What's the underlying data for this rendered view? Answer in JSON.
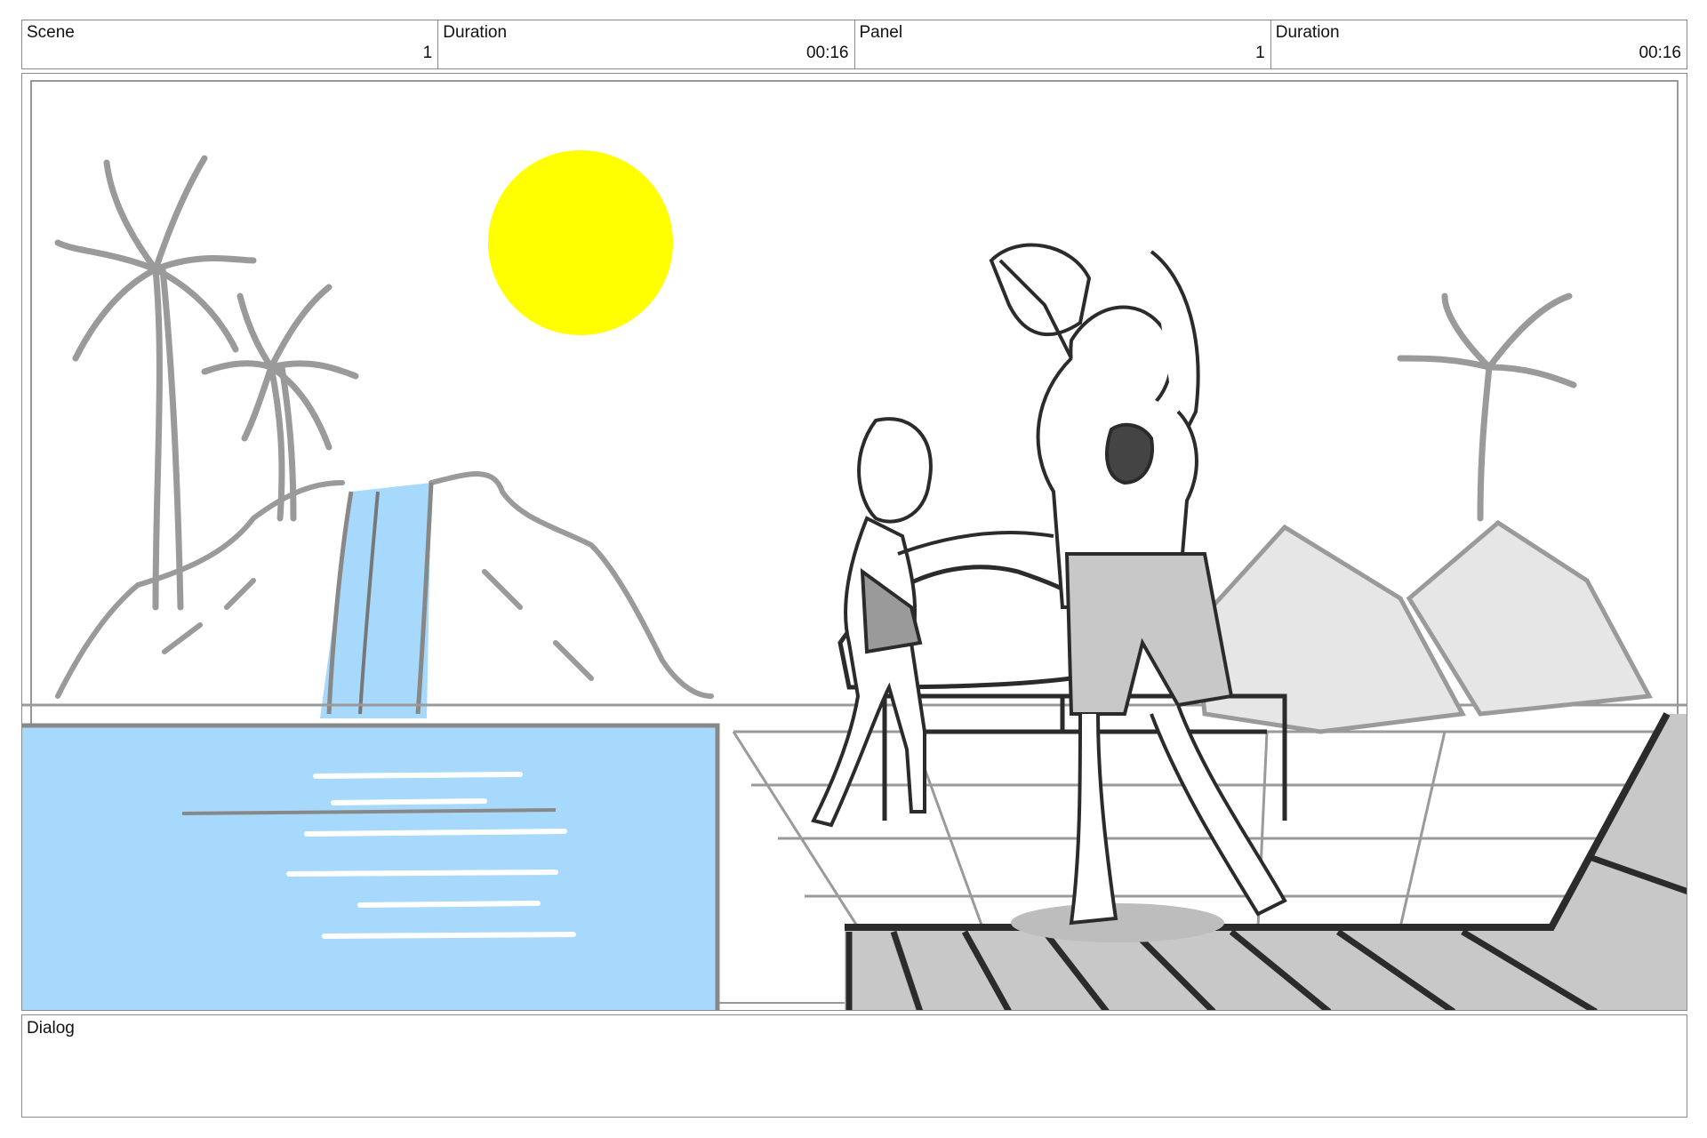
{
  "header": {
    "scene_label": "Scene",
    "scene_value": "1",
    "scene_duration_label": "Duration",
    "scene_duration_value": "00:16",
    "panel_label": "Panel",
    "panel_value": "1",
    "panel_duration_label": "Duration",
    "panel_duration_value": "00:16"
  },
  "dialog": {
    "label": "Dialog",
    "text": ""
  },
  "colors": {
    "sun": "#ffff00",
    "water": "#a6d9fb",
    "sketch_gray": "#9a9a9a",
    "dark_line": "#2b2b2b"
  },
  "illustration": {
    "icons": [
      "palm-tree-icon",
      "sun-icon",
      "waterfall-icon",
      "pool-icon",
      "tent-icon",
      "man-figure-icon",
      "woman-figure-icon",
      "lounger-icon",
      "deck-icon"
    ]
  }
}
